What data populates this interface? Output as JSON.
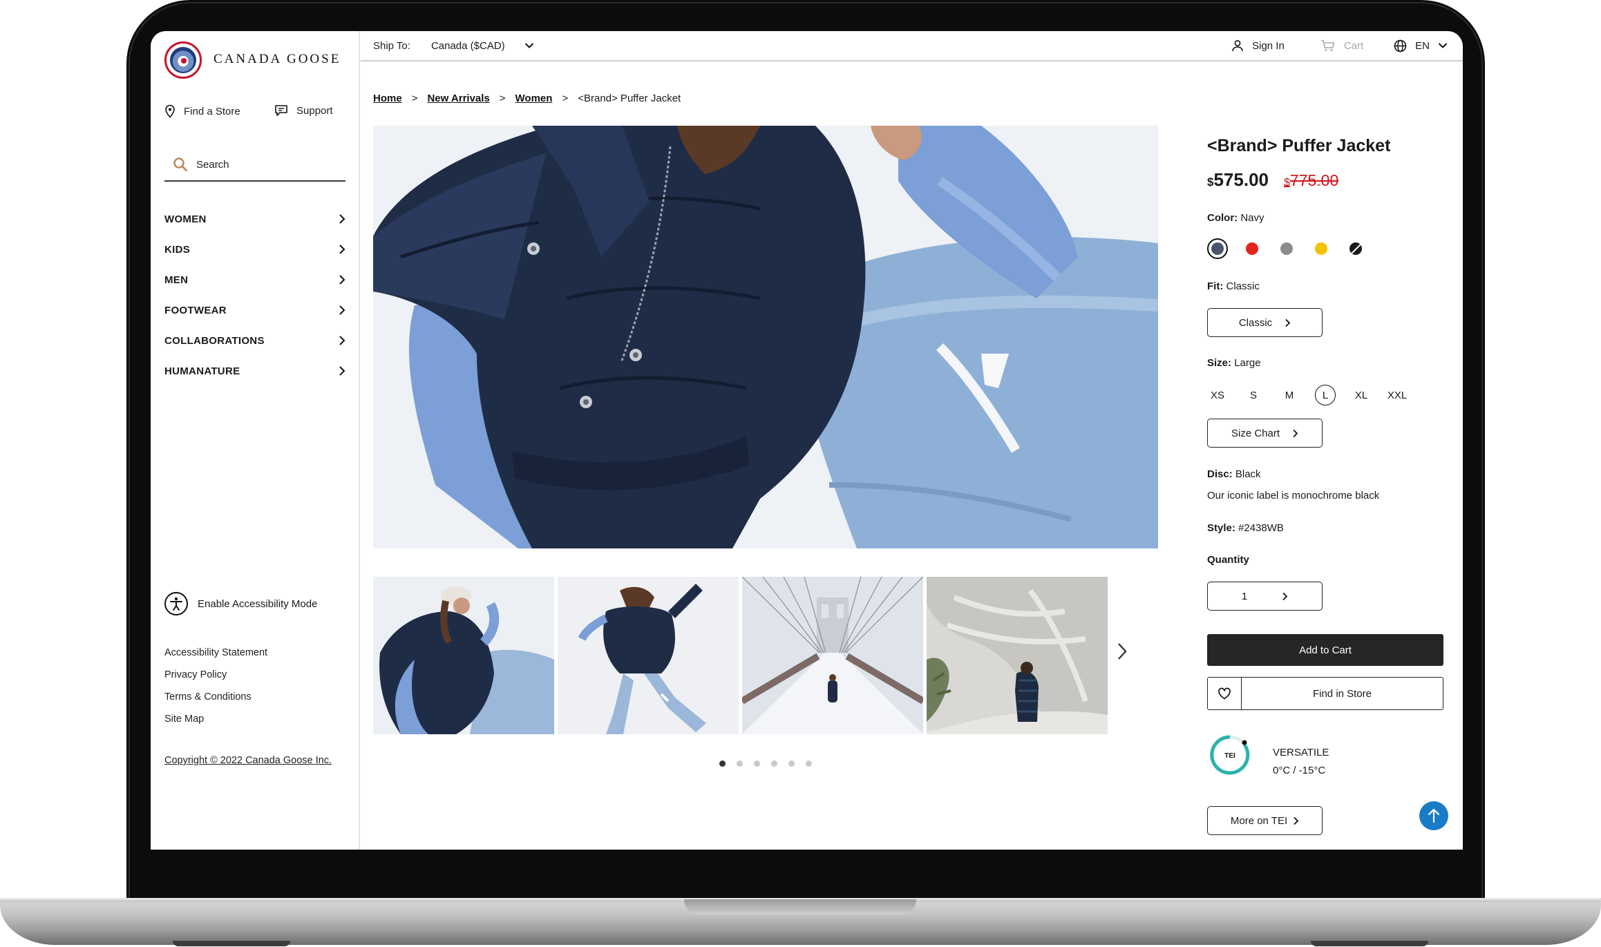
{
  "brand": {
    "name": "CANADA GOOSE"
  },
  "sidebar": {
    "find_store": "Find a Store",
    "support": "Support",
    "search_placeholder": "Search",
    "nav": [
      "WOMEN",
      "KIDS",
      "MEN",
      "FOOTWEAR",
      "COLLABORATIONS",
      "HUMANATURE"
    ],
    "accessibility": "Enable Accessibility Mode",
    "links": [
      "Accessibility Statement",
      "Privacy Policy",
      "Terms & Conditions",
      "Site Map"
    ],
    "copyright": "Copyright © 2022 Canada Goose Inc."
  },
  "topbar": {
    "ship_to_label": "Ship To:",
    "ship_to_value": "Canada ($CAD)",
    "sign_in": "Sign In",
    "cart": "Cart",
    "language": "EN"
  },
  "breadcrumb": {
    "home": "Home",
    "new_arrivals": "New Arrivals",
    "women": "Women",
    "current": "<Brand> Puffer Jacket",
    "separator": ">"
  },
  "gallery": {
    "active_index": 0,
    "dot_count": 6
  },
  "product": {
    "title": "<Brand> Puffer Jacket",
    "currency_symbol": "$",
    "price": "575.00",
    "old_price": "775.00",
    "color_label": "Color:",
    "color_value": "Navy",
    "swatch_colors": [
      "#47546a",
      "#e3241b",
      "#8c8c8c",
      "#f5c200",
      "#1a1a1a"
    ],
    "fit_label": "Fit:",
    "fit_value": "Classic",
    "fit_button": "Classic",
    "size_label": "Size:",
    "size_value": "Large",
    "sizes": [
      "XS",
      "S",
      "M",
      "L",
      "XL",
      "XXL"
    ],
    "selected_size": "L",
    "size_chart": "Size Chart",
    "disc_label": "Disc:",
    "disc_value": "Black",
    "disc_desc": "Our iconic label is monochrome black",
    "style_label": "Style:",
    "style_value": "#2438WB",
    "quantity_label": "Quantity",
    "quantity": "1",
    "add_to_cart": "Add to Cart",
    "find_in_store": "Find in Store",
    "tei_badge": "TEI",
    "tei_level": "VERSATILE",
    "tei_range": "0°C / -15°C",
    "more_tei": "More on TEI"
  },
  "colors": {
    "accent_red": "#d0141c",
    "scroll_top_blue": "#1a7cc6",
    "cart_button": "#262626",
    "tei_teal": "#2ab3ad"
  }
}
